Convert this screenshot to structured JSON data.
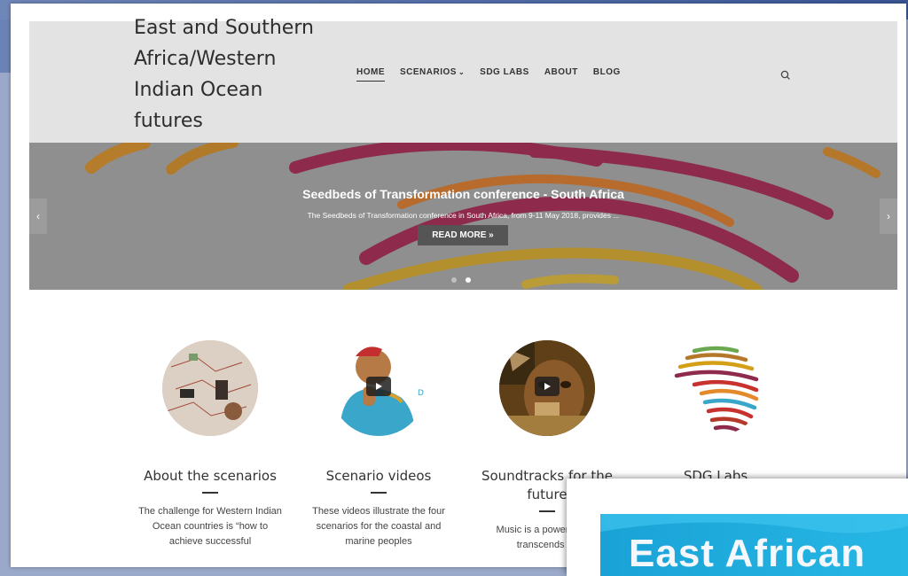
{
  "site": {
    "title": "East and Southern Africa/Western Indian Ocean futures"
  },
  "nav": {
    "items": [
      "HOME",
      "SCENARIOS",
      "SDG LABS",
      "ABOUT",
      "BLOG"
    ],
    "scenarios_caret": "⌄"
  },
  "slider": {
    "title": "Seedbeds of Transformation conference - South Africa",
    "text": "The Seedbeds of Transformation conference in South Africa, from 9-11 May 2018, provides ...",
    "button": "READ MORE »",
    "prev_icon": "‹",
    "next_icon": "›",
    "slide_count": 2,
    "active_slide": 2
  },
  "features": [
    {
      "title": "About the scenarios",
      "text": "The challenge for Western Indian Ocean countries is “how to achieve successful"
    },
    {
      "title": "Scenario videos",
      "text": "These videos illustrate the four scenarios for the coastal and marine peoples"
    },
    {
      "title": "Soundtracks for the future",
      "text": "Music is a powerful that transcends cu"
    },
    {
      "title": "SDG Labs",
      "text": ""
    }
  ],
  "overlay": {
    "banner_text": "East African"
  },
  "colors": {
    "header_bg": "#e3e3e3",
    "slider_arc_1": "#c8781e",
    "slider_arc_2": "#9c2448",
    "overlay_blue": "#1aa2d6"
  },
  "icons": {
    "search": "search-icon",
    "play": "play-icon"
  }
}
